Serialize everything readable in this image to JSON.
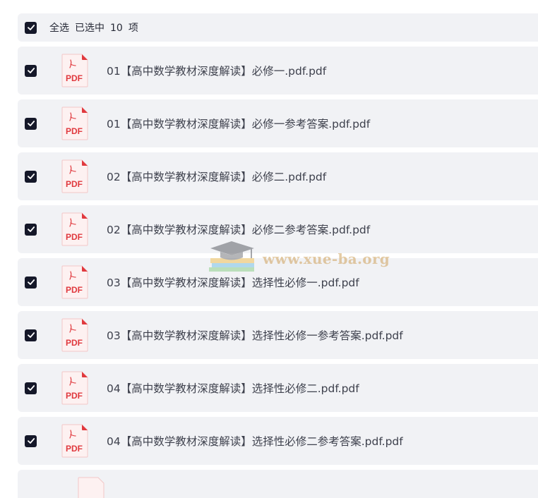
{
  "header": {
    "select_all": "全选",
    "selected_prefix": "已选中",
    "selected_count": "10",
    "selected_suffix": "项"
  },
  "files": [
    {
      "name": "01【高中数学教材深度解读】必修一.pdf.pdf",
      "icon": "pdf-icon",
      "checked": true
    },
    {
      "name": "01【高中数学教材深度解读】必修一参考答案.pdf.pdf",
      "icon": "pdf-icon",
      "checked": true
    },
    {
      "name": "02【高中数学教材深度解读】必修二.pdf.pdf",
      "icon": "pdf-icon",
      "checked": true
    },
    {
      "name": "02【高中数学教材深度解读】必修二参考答案.pdf.pdf",
      "icon": "pdf-icon",
      "checked": true
    },
    {
      "name": "03【高中数学教材深度解读】选择性必修一.pdf.pdf",
      "icon": "pdf-icon",
      "checked": true
    },
    {
      "name": "03【高中数学教材深度解读】选择性必修一参考答案.pdf.pdf",
      "icon": "pdf-icon",
      "checked": true
    },
    {
      "name": "04【高中数学教材深度解读】选择性必修二.pdf.pdf",
      "icon": "pdf-icon",
      "checked": true
    },
    {
      "name": "04【高中数学教材深度解读】选择性必修二参考答案.pdf.pdf",
      "icon": "pdf-icon",
      "checked": true
    }
  ],
  "pdf_label": "PDF",
  "watermark": "www.xue-ba.org",
  "colors": {
    "checkbox": "#151829",
    "row_bg": "#f1f2f5",
    "pdf_red": "#e0393e"
  }
}
